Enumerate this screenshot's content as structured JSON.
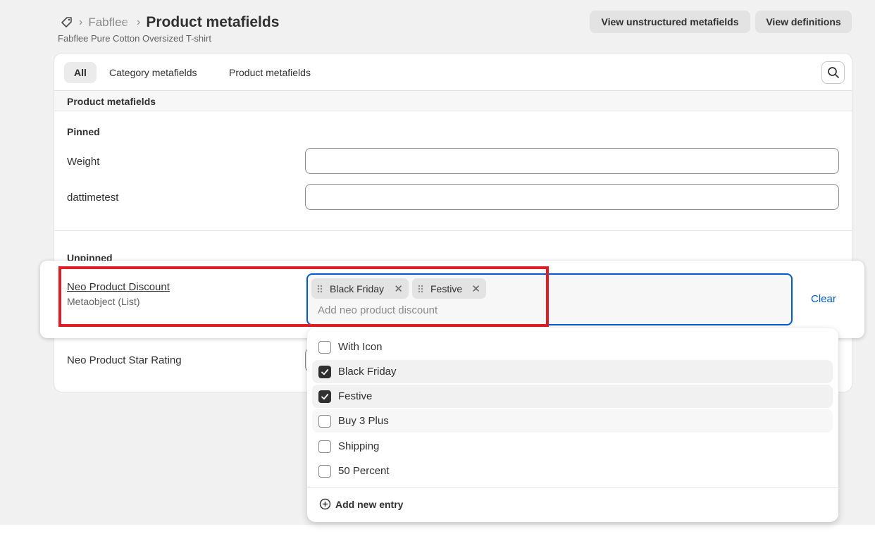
{
  "header": {
    "breadcrumb_parent": "Fabflee",
    "title": "Product metafields",
    "subtitle": "Fabflee Pure Cotton Oversized T-shirt",
    "btn_unstructured": "View unstructured metafields",
    "btn_definitions": "View definitions"
  },
  "tabs": [
    {
      "label": "All"
    },
    {
      "label": "Category metafields"
    },
    {
      "label": "Product metafields"
    }
  ],
  "section_title": "Product metafields",
  "pinned": {
    "label": "Pinned",
    "fields": [
      {
        "label": "Weight",
        "value": ""
      },
      {
        "label": "dattimetest",
        "value": ""
      }
    ]
  },
  "unpinned": {
    "label": "Unpinned",
    "active_field": {
      "label": "Neo Product Discount",
      "type": "Metaobject (List)",
      "chips": [
        "Black Friday",
        "Festive"
      ],
      "placeholder": "Add neo product discount",
      "clear_label": "Clear"
    },
    "next_field_label": "Neo Product Star Rating"
  },
  "dropdown": {
    "options": [
      {
        "label": "With Icon",
        "checked": false
      },
      {
        "label": "Black Friday",
        "checked": true
      },
      {
        "label": "Festive",
        "checked": true
      },
      {
        "label": "Buy 3 Plus",
        "checked": false
      },
      {
        "label": "Shipping",
        "checked": false
      },
      {
        "label": "50 Percent",
        "checked": false
      }
    ],
    "add_new_label": "Add new entry"
  },
  "colors": {
    "accent_blue": "#005bd3",
    "highlight_red": "#e01c24"
  }
}
